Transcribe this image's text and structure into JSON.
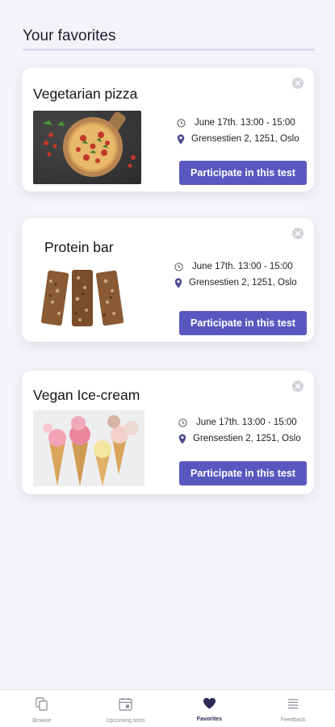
{
  "page": {
    "title": "Your favorites"
  },
  "cards": [
    {
      "title": "Vegetarian pizza",
      "date": "June 17th. 13:00 - 15:00",
      "address": "Grensestien 2, 1251, Oslo",
      "cta": "Participate in this test",
      "image": "pizza-photo"
    },
    {
      "title": "Protein bar",
      "date": "June 17th. 13:00 - 15:00",
      "address": "Grensestien 2, 1251, Oslo",
      "cta": "Participate in this test",
      "image": "protein-bar-photo"
    },
    {
      "title": "Vegan Ice-cream",
      "date": "June 17th. 13:00 - 15:00",
      "address": "Grensestien 2, 1251, Oslo",
      "cta": "Participate in this test",
      "image": "ice-cream-photo"
    }
  ],
  "nav": {
    "items": [
      {
        "label": "Browse",
        "icon": "browse-icon",
        "active": false
      },
      {
        "label": "Upcoming tests",
        "icon": "calendar-icon",
        "active": false
      },
      {
        "label": "Favorites",
        "icon": "heart-icon",
        "active": true
      },
      {
        "label": "Feedback",
        "icon": "feedback-icon",
        "active": false
      }
    ]
  },
  "colors": {
    "accent": "#5a57c0",
    "background": "#f3f4f9",
    "nav_active": "#2b2b55"
  }
}
